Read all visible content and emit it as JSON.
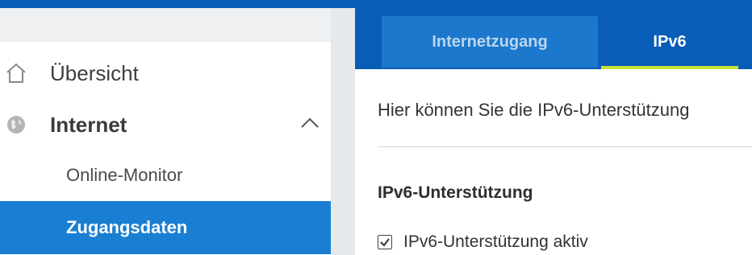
{
  "sidebar": {
    "items": [
      {
        "label": "Übersicht",
        "icon": "home-icon"
      },
      {
        "label": "Internet",
        "icon": "globe-icon",
        "expanded": true
      },
      {
        "label": "Online-Monitor"
      },
      {
        "label": "Zugangsdaten",
        "selected": true
      }
    ]
  },
  "tabs": [
    {
      "label": "Internetzugang",
      "active": false
    },
    {
      "label": "IPv6",
      "active": true
    }
  ],
  "main": {
    "intro": "Hier können Sie die IPv6-Unterstützung",
    "section_title": "IPv6-Unterstützung",
    "checkbox": {
      "label": "IPv6-Unterstützung aktiv",
      "checked": true
    }
  },
  "colors": {
    "brand_blue": "#0a5db7",
    "selected_blue": "#1a7fd3",
    "active_tab_accent": "#c9e23a"
  }
}
